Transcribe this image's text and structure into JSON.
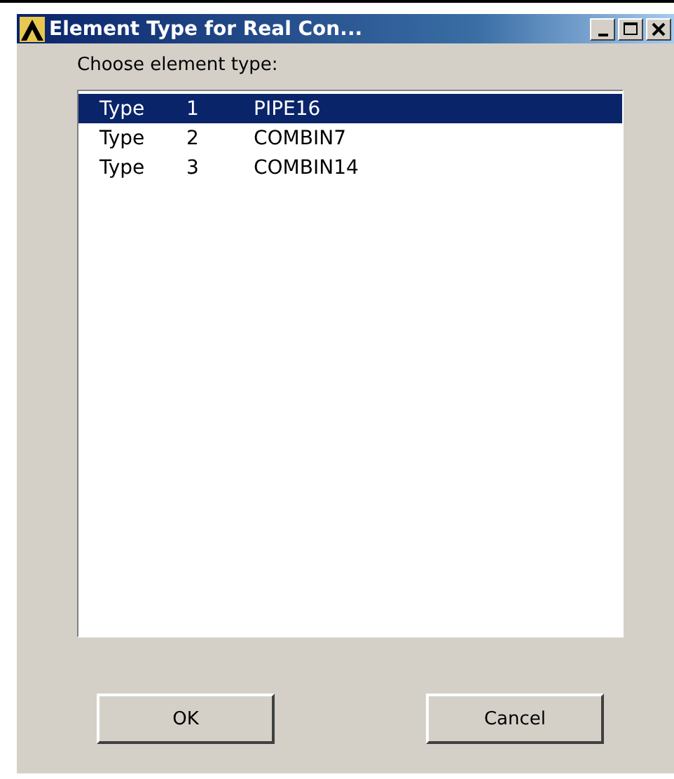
{
  "window": {
    "title": "Element Type for Real Con..."
  },
  "prompt": "Choose element type:",
  "list": [
    {
      "label": "Type",
      "number": "1",
      "name": "PIPE16",
      "selected": true
    },
    {
      "label": "Type",
      "number": "2",
      "name": "COMBIN7",
      "selected": false
    },
    {
      "label": "Type",
      "number": "3",
      "name": "COMBIN14",
      "selected": false
    }
  ],
  "buttons": [
    "OK",
    "Cancel"
  ]
}
